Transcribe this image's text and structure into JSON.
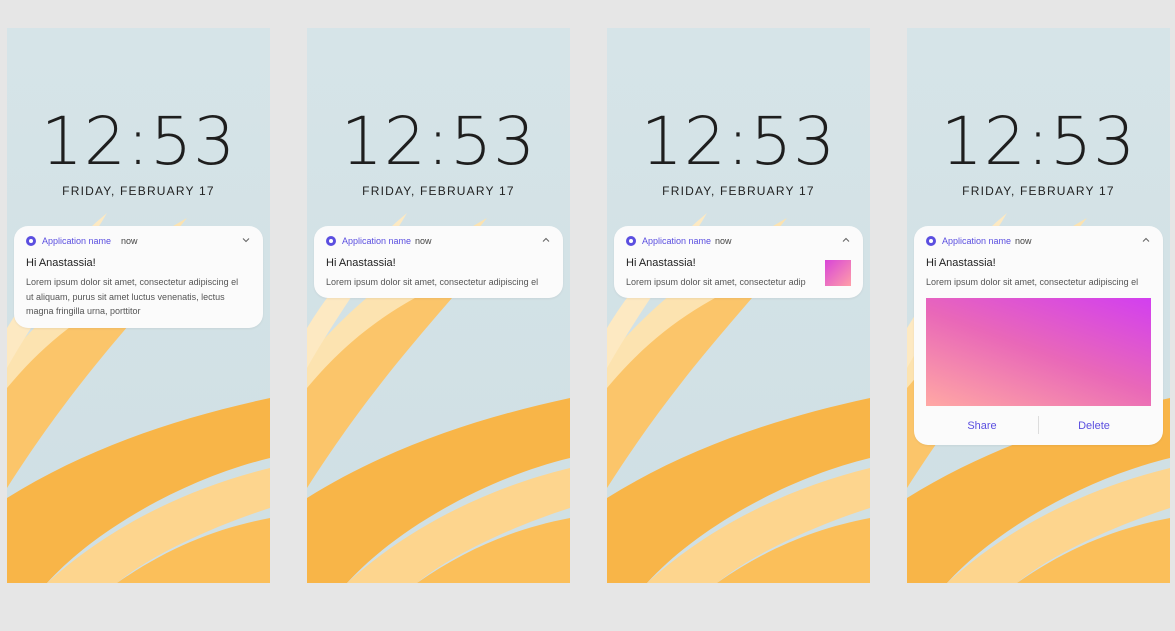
{
  "screens": [
    {
      "time": "12:53",
      "date": "FRIDAY, FEBRUARY 17",
      "notification": {
        "app_name": "Application name",
        "timestamp": "now",
        "title": "Hi Anastassia!",
        "body": "Lorem ipsum dolor sit amet, consectetur adipiscing el ut aliquam, purus sit amet luctus venenatis, lectus magna fringilla urna, porttitor",
        "body_lines": [
          "Lorem ipsum dolor sit amet, consectetur adipiscing el",
          "ut aliquam, purus sit amet luctus venenatis, lectus",
          "magna fringilla urna, porttitor"
        ],
        "expand_icon": "chevron-down-icon"
      }
    },
    {
      "time": "12:53",
      "date": "FRIDAY, FEBRUARY 17",
      "notification": {
        "app_name": "Application name",
        "timestamp": "now",
        "title": "Hi Anastassia!",
        "body": "Lorem ipsum dolor sit amet, consectetur adipiscing el",
        "expand_icon": "chevron-up-icon"
      }
    },
    {
      "time": "12:53",
      "date": "FRIDAY, FEBRUARY 17",
      "notification": {
        "app_name": "Application name",
        "timestamp": "now",
        "title": "Hi Anastassia!",
        "body": "Lorem ipsum dolor sit amet, consectetur adip",
        "expand_icon": "chevron-up-icon",
        "has_thumbnail": true
      }
    },
    {
      "time": "12:53",
      "date": "FRIDAY, FEBRUARY 17",
      "notification": {
        "app_name": "Application name",
        "timestamp": "now",
        "title": "Hi Anastassia!",
        "body": "Lorem ipsum dolor sit amet, consectetur adipiscing el",
        "expand_icon": "chevron-up-icon",
        "has_image": true,
        "actions": [
          "Share",
          "Delete"
        ]
      }
    }
  ],
  "colors": {
    "accent": "#5b4fe0",
    "page_background": "#e6e6e6",
    "wallpaper_sky": "#d4e3e7",
    "wallpaper_petal": "#f7b84a",
    "image_gradient_start": "#d23ff0",
    "image_gradient_end": "#ffa8a4"
  }
}
